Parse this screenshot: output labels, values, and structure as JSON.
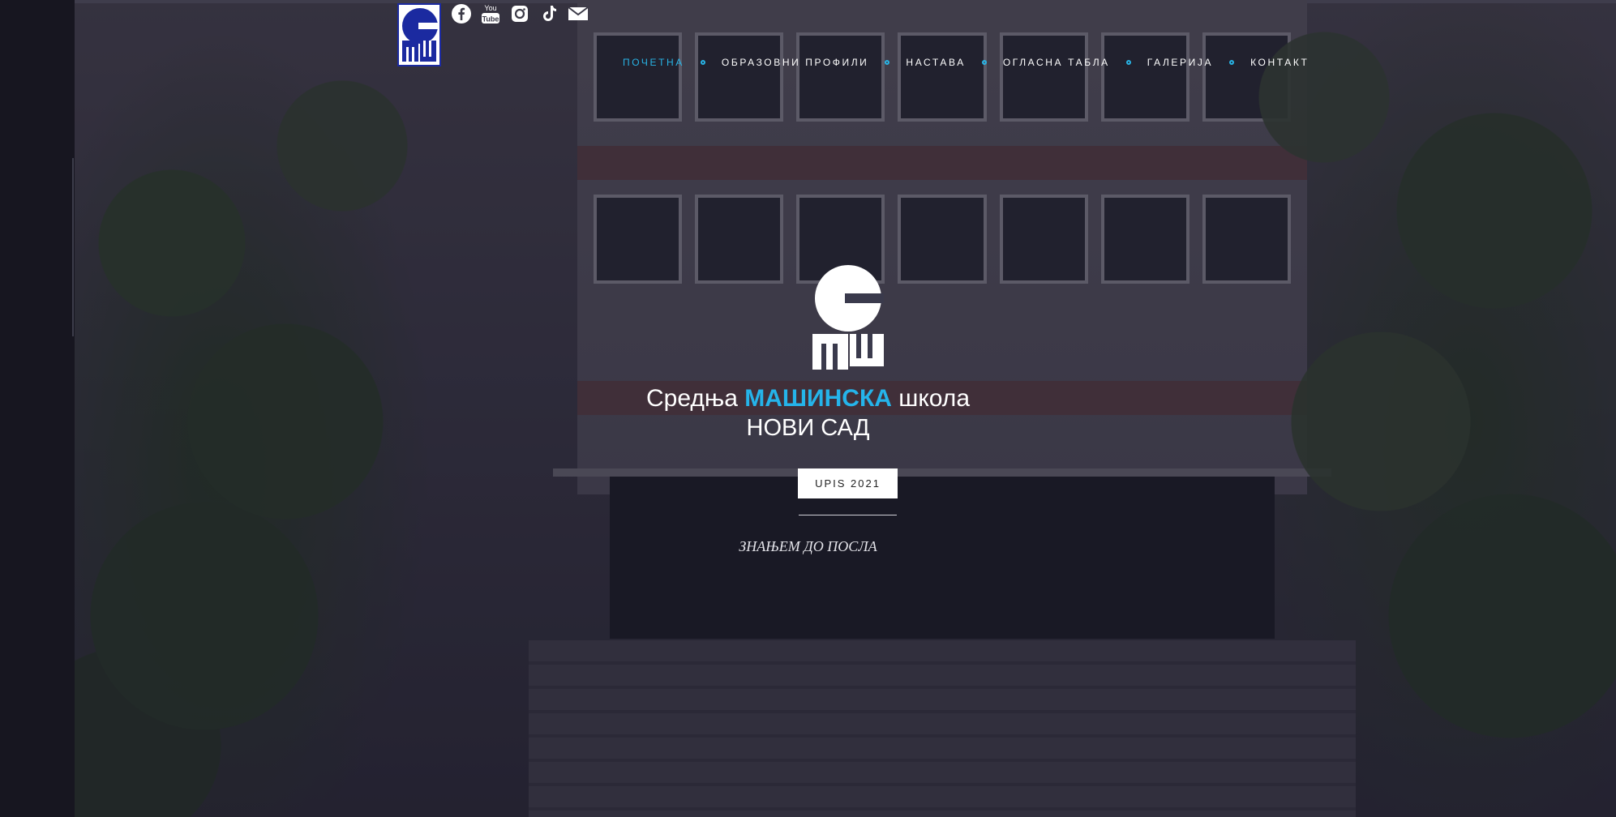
{
  "header": {
    "social_icons": [
      "facebook-icon",
      "youtube-icon",
      "instagram-icon",
      "tiktok-icon",
      "envelope-icon"
    ],
    "youtube_text_top": "You",
    "youtube_text_bottom": "Tube"
  },
  "nav": {
    "items": [
      {
        "label": "ПОЧЕТНА",
        "active": true
      },
      {
        "label": "ОБРАЗОВНИ ПРОФИЛИ"
      },
      {
        "label": "НАСТАВА"
      },
      {
        "label": "ОГЛАСНА ТАБЛА"
      },
      {
        "label": "ГАЛЕРИЈА"
      },
      {
        "label": "КОНТАКТ"
      }
    ]
  },
  "hero": {
    "title_part1": "Средња ",
    "title_accent": "МАШИНСКА",
    "title_part2": " школа",
    "subtitle": "НОВИ САД",
    "button_label": "UPIS 2021",
    "motto": "ЗНАЊЕМ ДО ПОСЛА"
  },
  "colors": {
    "accent": "#25b4ea",
    "logo_blue": "#1b2aa0"
  }
}
